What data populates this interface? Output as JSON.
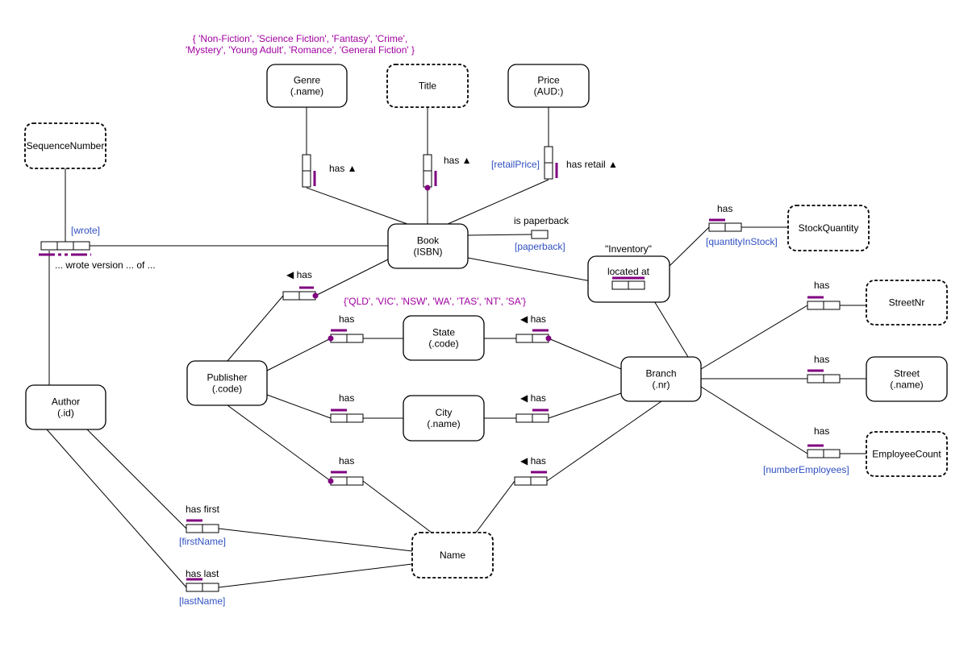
{
  "colors": {
    "uniqueness": "#800080",
    "role_name": "#3050c0",
    "value_constraint": "#a000a0"
  },
  "value_constraints": {
    "genre_line1": "{ 'Non-Fiction', 'Science Fiction', 'Fantasy', 'Crime',",
    "genre_line2": "'Mystery', 'Young Adult', 'Romance', 'General Fiction' }",
    "state": "{'QLD', 'VIC', 'NSW', 'WA', 'TAS', 'NT', 'SA'}"
  },
  "entities": {
    "genre": [
      "Genre",
      "(.name)"
    ],
    "title": [
      "Title"
    ],
    "price": [
      "Price",
      "(AUD:)"
    ],
    "seq": [
      "SequenceNumber"
    ],
    "book": [
      "Book",
      "(ISBN)"
    ],
    "stockq": [
      "StockQuantity"
    ],
    "streetnr": [
      "StreetNr"
    ],
    "state": [
      "State",
      "(.code)"
    ],
    "publisher": [
      "Publisher",
      "(.code)"
    ],
    "branch": [
      "Branch",
      "(.nr)"
    ],
    "street": [
      "Street",
      "(.name)"
    ],
    "city": [
      "City",
      "(.name)"
    ],
    "author": [
      "Author",
      "(.id)"
    ],
    "employee": [
      "EmployeeCount"
    ],
    "name": [
      "Name"
    ]
  },
  "objectified": {
    "name": "\"Inventory\"",
    "reading": "located at"
  },
  "readings": {
    "genre": "has ▲",
    "title": "has ▲",
    "price": "has retail ▲",
    "wrote": "... wrote version ... of ...",
    "paperback": "is paperback",
    "pub_book": "◀ has",
    "state_pub": "has",
    "state_branch": "◀ has",
    "city_pub": "has",
    "city_branch": "◀ has",
    "name_pub": "has",
    "name_branch": "◀ has",
    "first": "has first",
    "last": "has last",
    "stock": "has",
    "streetnr": "has",
    "street": "has",
    "employee": "has"
  },
  "role_names": {
    "wrote": "[wrote]",
    "price": "[retailPrice]",
    "paperback": "[paperback]",
    "stock": "[quantityInStock]",
    "employee": "[numberEmployees]",
    "first": "[firstName]",
    "last": "[lastName]"
  }
}
